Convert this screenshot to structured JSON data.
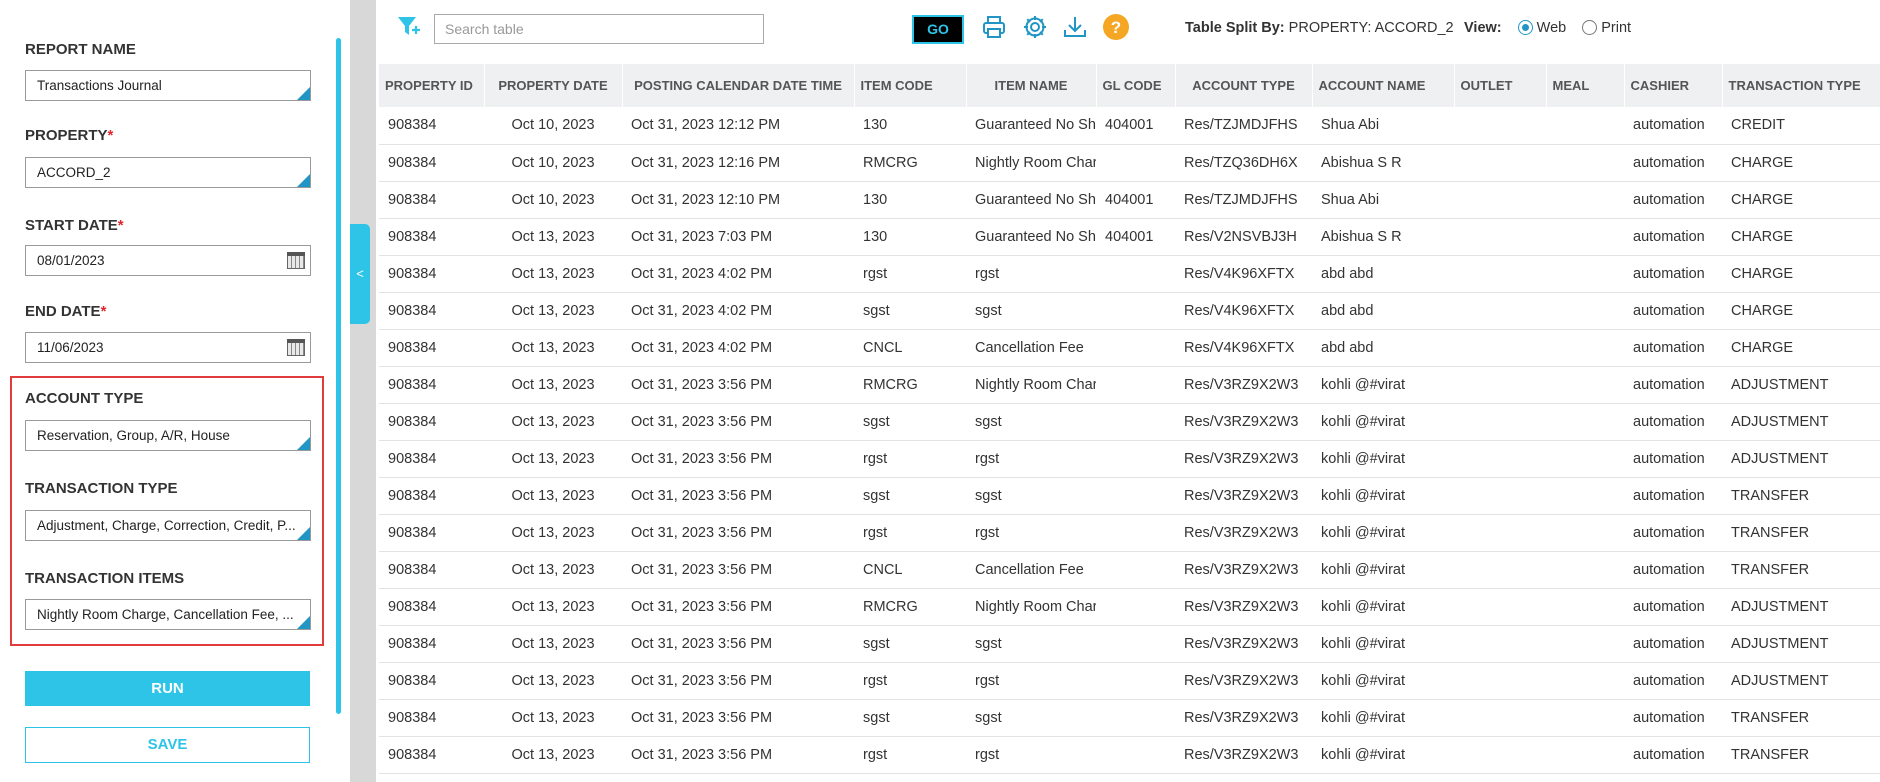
{
  "form": {
    "report_name_label": "REPORT NAME",
    "report_name_value": "Transactions Journal",
    "property_label": "PROPERTY",
    "property_value": "ACCORD_2",
    "start_date_label": "START DATE",
    "start_date_value": "08/01/2023",
    "end_date_label": "END DATE",
    "end_date_value": "11/06/2023",
    "account_type_label": "ACCOUNT TYPE",
    "account_type_value": "Reservation, Group, A/R, House",
    "transaction_type_label": "TRANSACTION TYPE",
    "transaction_type_value": "Adjustment, Charge, Correction, Credit, P...",
    "transaction_items_label": "TRANSACTION ITEMS",
    "transaction_items_value": "Nightly Room Charge, Cancellation Fee, ...",
    "required_mark": "*",
    "run_label": "RUN",
    "save_label": "SAVE"
  },
  "sidebar_toggle": "<",
  "toolbar": {
    "search_placeholder": "Search table",
    "go_label": "GO",
    "split_label": "Table Split By:",
    "split_value": "PROPERTY: ACCORD_2",
    "view_label": "View:",
    "view_web": "Web",
    "view_print": "Print",
    "help_glyph": "?"
  },
  "colors": {
    "accent": "#2ec4e7",
    "highlight_border": "#e23b3b",
    "help_icon": "#f5a623"
  },
  "icons": [
    "filter-icon",
    "print-icon",
    "settings-icon",
    "download-icon",
    "help-icon",
    "calendar-icon"
  ],
  "table": {
    "columns": [
      "PROPERTY ID",
      "PROPERTY DATE",
      "POSTING CALENDAR DATE TIME",
      "ITEM CODE",
      "ITEM NAME",
      "GL CODE",
      "ACCOUNT TYPE",
      "ACCOUNT NAME",
      "OUTLET",
      "MEAL",
      "CASHIER",
      "TRANSACTION TYPE"
    ],
    "rows": [
      [
        "908384",
        "Oct 10, 2023",
        "Oct 31, 2023 12:12 PM",
        "130",
        "Guaranteed No Show",
        "404001",
        "Res/TZJMDJFHS",
        "Shua Abi",
        "",
        "",
        "automation",
        "CREDIT"
      ],
      [
        "908384",
        "Oct 10, 2023",
        "Oct 31, 2023 12:16 PM",
        "RMCRG",
        "Nightly Room Charge",
        "",
        "Res/TZQ36DH6X",
        "Abishua S R",
        "",
        "",
        "automation",
        "CHARGE"
      ],
      [
        "908384",
        "Oct 10, 2023",
        "Oct 31, 2023 12:10 PM",
        "130",
        "Guaranteed No Show",
        "404001",
        "Res/TZJMDJFHS",
        "Shua Abi",
        "",
        "",
        "automation",
        "CHARGE"
      ],
      [
        "908384",
        "Oct 13, 2023",
        "Oct 31, 2023 7:03 PM",
        "130",
        "Guaranteed No Show",
        "404001",
        "Res/V2NSVBJ3H",
        "Abishua S R",
        "",
        "",
        "automation",
        "CHARGE"
      ],
      [
        "908384",
        "Oct 13, 2023",
        "Oct 31, 2023 4:02 PM",
        "rgst",
        "rgst",
        "",
        "Res/V4K96XFTX",
        "abd abd",
        "",
        "",
        "automation",
        "CHARGE"
      ],
      [
        "908384",
        "Oct 13, 2023",
        "Oct 31, 2023 4:02 PM",
        "sgst",
        "sgst",
        "",
        "Res/V4K96XFTX",
        "abd abd",
        "",
        "",
        "automation",
        "CHARGE"
      ],
      [
        "908384",
        "Oct 13, 2023",
        "Oct 31, 2023 4:02 PM",
        "CNCL",
        "Cancellation Fee",
        "",
        "Res/V4K96XFTX",
        "abd abd",
        "",
        "",
        "automation",
        "CHARGE"
      ],
      [
        "908384",
        "Oct 13, 2023",
        "Oct 31, 2023 3:56 PM",
        "RMCRG",
        "Nightly Room Charge",
        "",
        "Res/V3RZ9X2W3",
        "kohli @#virat",
        "",
        "",
        "automation",
        "ADJUSTMENT"
      ],
      [
        "908384",
        "Oct 13, 2023",
        "Oct 31, 2023 3:56 PM",
        "sgst",
        "sgst",
        "",
        "Res/V3RZ9X2W3",
        "kohli @#virat",
        "",
        "",
        "automation",
        "ADJUSTMENT"
      ],
      [
        "908384",
        "Oct 13, 2023",
        "Oct 31, 2023 3:56 PM",
        "rgst",
        "rgst",
        "",
        "Res/V3RZ9X2W3",
        "kohli @#virat",
        "",
        "",
        "automation",
        "ADJUSTMENT"
      ],
      [
        "908384",
        "Oct 13, 2023",
        "Oct 31, 2023 3:56 PM",
        "sgst",
        "sgst",
        "",
        "Res/V3RZ9X2W3",
        "kohli @#virat",
        "",
        "",
        "automation",
        "TRANSFER"
      ],
      [
        "908384",
        "Oct 13, 2023",
        "Oct 31, 2023 3:56 PM",
        "rgst",
        "rgst",
        "",
        "Res/V3RZ9X2W3",
        "kohli @#virat",
        "",
        "",
        "automation",
        "TRANSFER"
      ],
      [
        "908384",
        "Oct 13, 2023",
        "Oct 31, 2023 3:56 PM",
        "CNCL",
        "Cancellation Fee",
        "",
        "Res/V3RZ9X2W3",
        "kohli @#virat",
        "",
        "",
        "automation",
        "TRANSFER"
      ],
      [
        "908384",
        "Oct 13, 2023",
        "Oct 31, 2023 3:56 PM",
        "RMCRG",
        "Nightly Room Charge",
        "",
        "Res/V3RZ9X2W3",
        "kohli @#virat",
        "",
        "",
        "automation",
        "ADJUSTMENT"
      ],
      [
        "908384",
        "Oct 13, 2023",
        "Oct 31, 2023 3:56 PM",
        "sgst",
        "sgst",
        "",
        "Res/V3RZ9X2W3",
        "kohli @#virat",
        "",
        "",
        "automation",
        "ADJUSTMENT"
      ],
      [
        "908384",
        "Oct 13, 2023",
        "Oct 31, 2023 3:56 PM",
        "rgst",
        "rgst",
        "",
        "Res/V3RZ9X2W3",
        "kohli @#virat",
        "",
        "",
        "automation",
        "ADJUSTMENT"
      ],
      [
        "908384",
        "Oct 13, 2023",
        "Oct 31, 2023 3:56 PM",
        "sgst",
        "sgst",
        "",
        "Res/V3RZ9X2W3",
        "kohli @#virat",
        "",
        "",
        "automation",
        "TRANSFER"
      ],
      [
        "908384",
        "Oct 13, 2023",
        "Oct 31, 2023 3:56 PM",
        "rgst",
        "rgst",
        "",
        "Res/V3RZ9X2W3",
        "kohli @#virat",
        "",
        "",
        "automation",
        "TRANSFER"
      ]
    ]
  }
}
